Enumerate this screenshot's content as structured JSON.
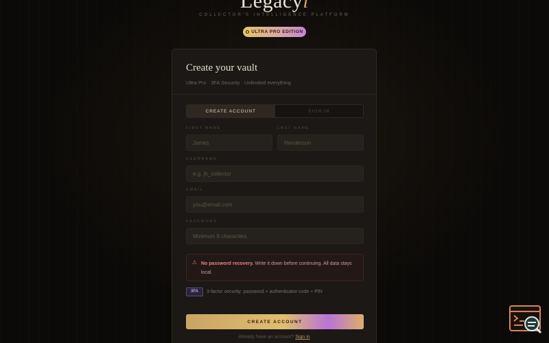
{
  "brand": {
    "name_main": "Legacy",
    "name_accent": "i",
    "tagline": "COLLECTOR'S INTELLIGENCE PLATFORM",
    "edition": "ULTRA PRO EDITION"
  },
  "card": {
    "title": "Create your vault",
    "subtitle": "Ultra Pro · 3FA Security · Unlimited everything",
    "tabs": [
      {
        "label": "CREATE ACCOUNT",
        "active": true
      },
      {
        "label": "SIGN IN",
        "active": false
      }
    ],
    "fields": {
      "first_name": {
        "label": "FIRST NAME",
        "placeholder": "James"
      },
      "last_name": {
        "label": "LAST NAME",
        "placeholder": "Henderson"
      },
      "username": {
        "label": "USERNAME",
        "placeholder": "e.g. jh_collector"
      },
      "email": {
        "label": "EMAIL",
        "placeholder": "you@email.com"
      },
      "password": {
        "label": "PASSWORD",
        "placeholder": "Minimum 8 characters"
      }
    },
    "warning": {
      "bold": "No password recovery.",
      "text": " Write it down before continuing. All data stays local."
    },
    "security": {
      "badge": "3FA",
      "text": "3-factor security: password + authenticator code + PIN"
    },
    "cta_label": "CREATE ACCOUNT",
    "footer": {
      "prompt": "Already have an account?",
      "link": "Sign in"
    }
  },
  "colors": {
    "background": "#0c0a08",
    "card": "#1b1815",
    "accent_gold": "#c9a36b",
    "accent_purple": "#b873d8",
    "warning_red": "#e7857a"
  },
  "icons": [
    "warning-icon",
    "ring-icon",
    "terminal-search-icon"
  ]
}
